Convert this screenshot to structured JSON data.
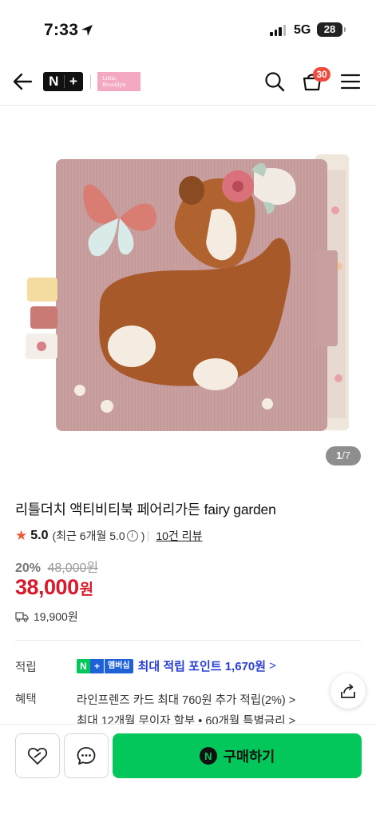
{
  "status_bar": {
    "time": "7:33",
    "network": "5G",
    "battery": "28"
  },
  "header": {
    "brand_badge": "N+",
    "store_logo_lines": [
      "Little",
      "Brooklyn"
    ],
    "cart_count": "30",
    "icons": [
      "back-arrow-icon",
      "search-icon",
      "cart-icon",
      "menu-icon"
    ]
  },
  "gallery": {
    "current": "1",
    "total": "/7"
  },
  "product": {
    "title": "리틀더치 액티비티북 페어리가든 fairy garden",
    "rating_score": "5.0",
    "rating_detail": "(최근 6개월 5.0",
    "rating_close": ")",
    "review_link": "10건 리뷰",
    "discount_pct": "20%",
    "original_price": "48,000원",
    "price_number": "38,000",
    "price_unit": "원",
    "shipping_fee": "19,900원"
  },
  "points": {
    "label": "적립",
    "badge_n": "N",
    "badge_plus": "+",
    "badge_member": "멤버십",
    "text": "최대 적립 포인트 1,670원",
    "chevron": ">"
  },
  "benefit": {
    "label": "혜택",
    "line1": "라인프렌즈 카드 최대 760원 추가 적립(2%) >",
    "line2": "최대 12개월 무이자 할부 • 60개월 특별금리 >"
  },
  "bottom_bar": {
    "buy_logo": "N",
    "buy_label": "구매하기"
  },
  "colors": {
    "accent_green": "#03c75a",
    "price_red": "#d91a2a",
    "points_blue": "#2a40d4",
    "cart_badge": "#f04a3c"
  }
}
